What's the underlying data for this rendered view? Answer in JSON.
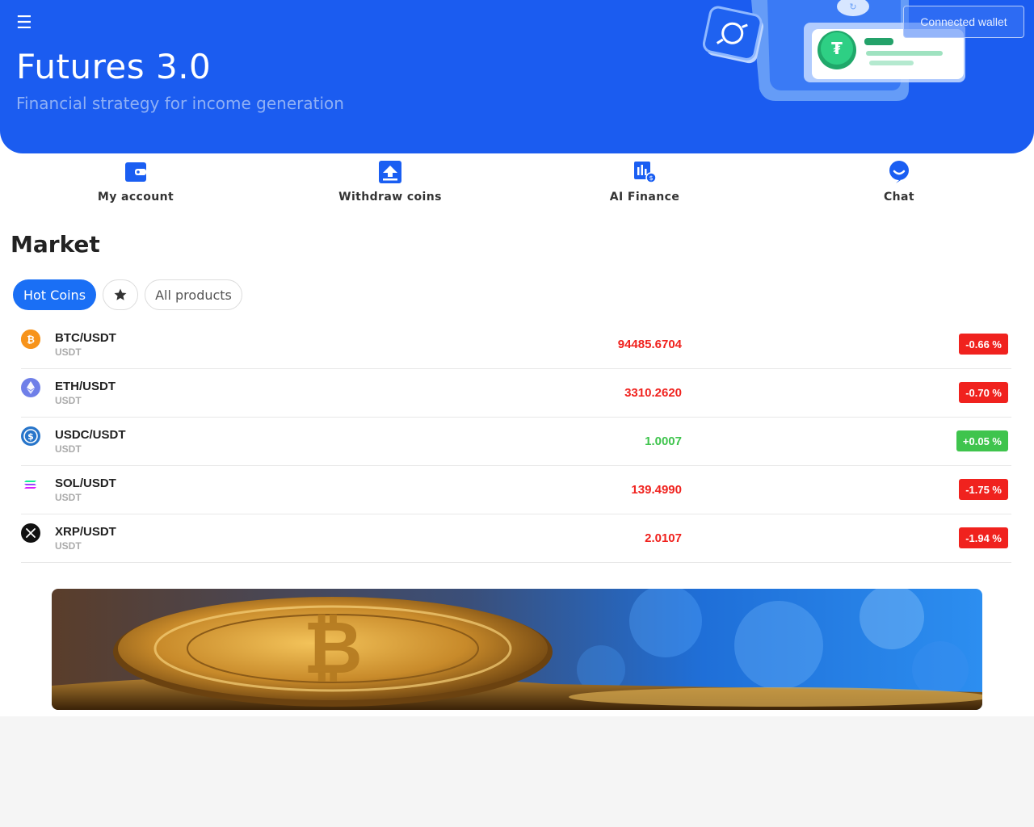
{
  "header": {
    "title": "Futures 3.0",
    "subtitle": "Financial strategy for income generation",
    "wallet_button": "Connected wallet",
    "menu_icon": "hamburger-menu-icon"
  },
  "quick_nav": [
    {
      "label": "My account",
      "icon": "wallet-icon"
    },
    {
      "label": "Withdraw coins",
      "icon": "withdraw-icon"
    },
    {
      "label": "AI Finance",
      "icon": "ai-finance-icon"
    },
    {
      "label": "Chat",
      "icon": "chat-icon"
    }
  ],
  "market": {
    "title": "Market",
    "tabs": {
      "hot": "Hot Coins",
      "favorites_icon": "star-icon",
      "all": "All products"
    },
    "columns": [
      "pair",
      "quote",
      "price",
      "change"
    ],
    "rows": [
      {
        "pair": "BTC/USDT",
        "quote": "USDT",
        "price": "94485.6704",
        "change": "-0.66 %",
        "trend": "down",
        "icon": "bitcoin-icon"
      },
      {
        "pair": "ETH/USDT",
        "quote": "USDT",
        "price": "3310.2620",
        "change": "-0.70 %",
        "trend": "down",
        "icon": "ethereum-icon"
      },
      {
        "pair": "USDC/USDT",
        "quote": "USDT",
        "price": "1.0007",
        "change": "+0.05 %",
        "trend": "up",
        "icon": "usdc-icon"
      },
      {
        "pair": "SOL/USDT",
        "quote": "USDT",
        "price": "139.4990",
        "change": "-1.75 %",
        "trend": "down",
        "icon": "solana-icon"
      },
      {
        "pair": "XRP/USDT",
        "quote": "USDT",
        "price": "2.0107",
        "change": "-1.94 %",
        "trend": "down",
        "icon": "xrp-icon"
      }
    ]
  },
  "colors": {
    "brand": "#1b5cf0",
    "tab_active": "#1a6ff5",
    "down": "#f0221e",
    "up": "#3fc44d"
  }
}
